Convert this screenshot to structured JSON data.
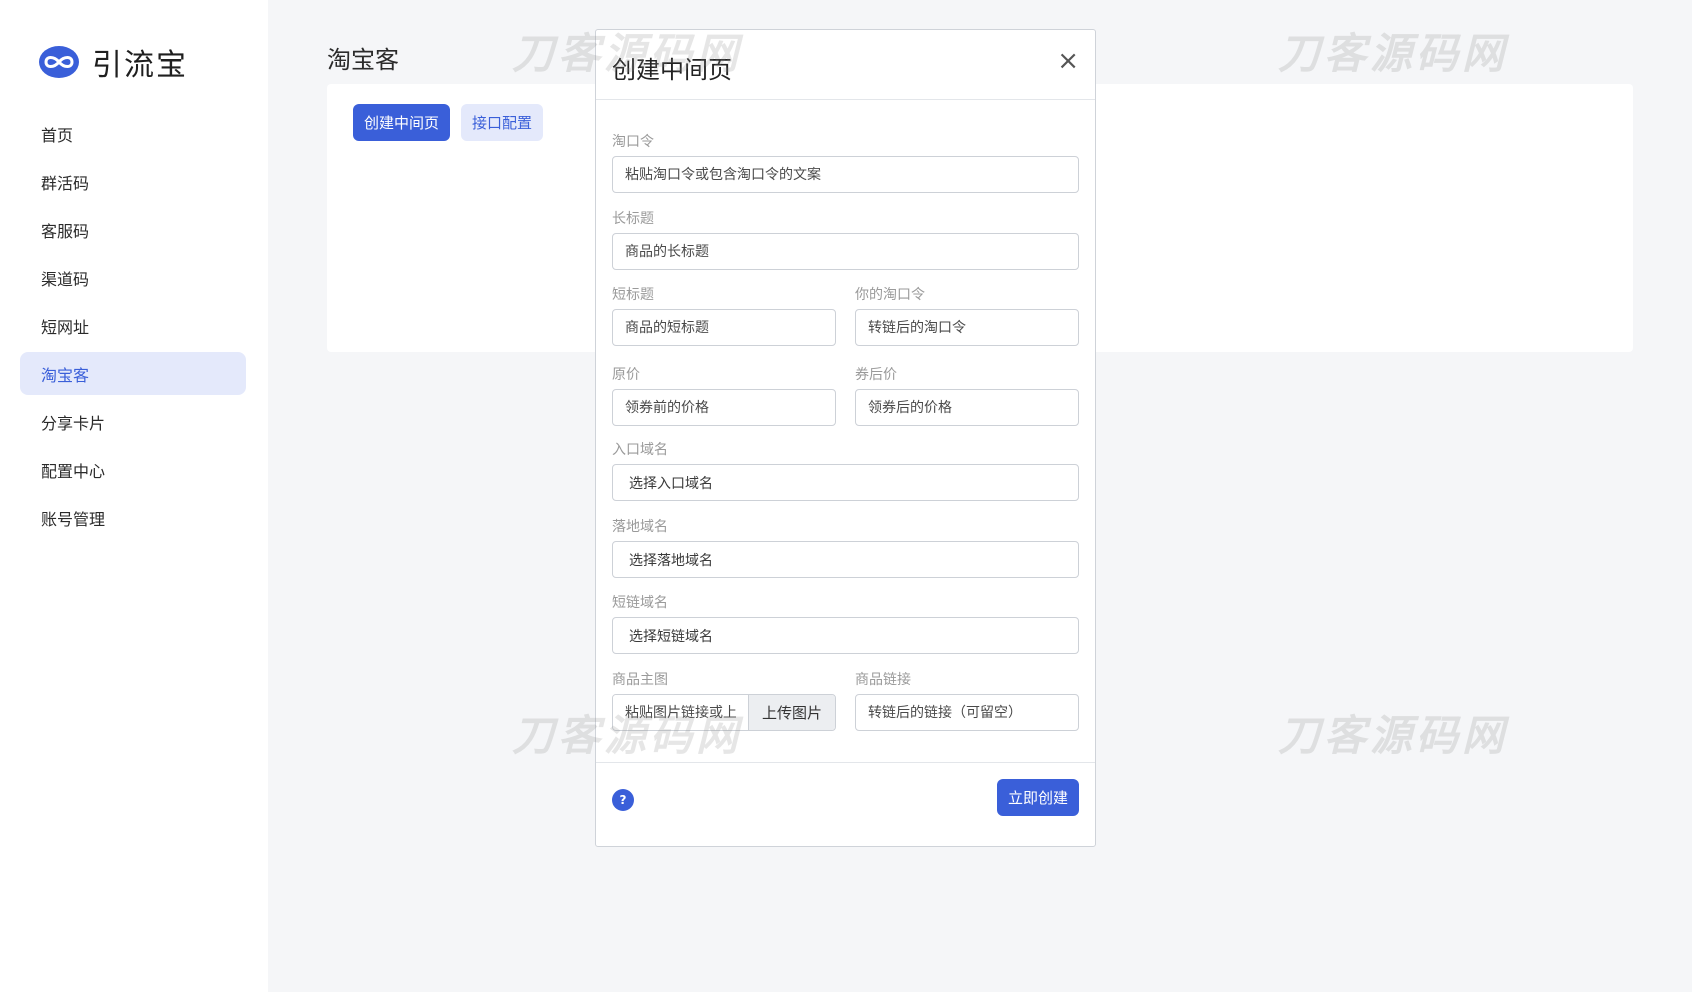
{
  "brand": {
    "name": "引流宝",
    "logo_icon": "infinity-logo-icon",
    "accent": "#3a5fd9"
  },
  "sidebar": {
    "items": [
      {
        "label": "首页",
        "active": false
      },
      {
        "label": "群活码",
        "active": false
      },
      {
        "label": "客服码",
        "active": false
      },
      {
        "label": "渠道码",
        "active": false
      },
      {
        "label": "短网址",
        "active": false
      },
      {
        "label": "淘宝客",
        "active": true
      },
      {
        "label": "分享卡片",
        "active": false
      },
      {
        "label": "配置中心",
        "active": false
      },
      {
        "label": "账号管理",
        "active": false
      }
    ]
  },
  "main": {
    "title": "淘宝客",
    "create_button": "创建中间页",
    "api_config_button": "接口配置"
  },
  "watermark": {
    "text": "刀客源码网"
  },
  "modal": {
    "title": "创建中间页",
    "close_icon": "close-icon",
    "fields": {
      "tkl": {
        "label": "淘口令",
        "placeholder": "粘贴淘口令或包含淘口令的文案"
      },
      "long_title": {
        "label": "长标题",
        "placeholder": "商品的长标题"
      },
      "short_title": {
        "label": "短标题",
        "placeholder": "商品的短标题"
      },
      "your_tkl": {
        "label": "你的淘口令",
        "placeholder": "转链后的淘口令"
      },
      "original_price": {
        "label": "原价",
        "placeholder": "领券前的价格"
      },
      "coupon_price": {
        "label": "券后价",
        "placeholder": "领券后的价格"
      },
      "entry_domain": {
        "label": "入口域名",
        "value": "选择入口域名"
      },
      "landing_domain": {
        "label": "落地域名",
        "value": "选择落地域名"
      },
      "short_domain": {
        "label": "短链域名",
        "value": "选择短链域名"
      },
      "main_image": {
        "label": "商品主图",
        "placeholder": "粘贴图片链接或上传",
        "upload_label": "上传图片"
      },
      "product_link": {
        "label": "商品链接",
        "placeholder": "转链后的链接（可留空）"
      }
    },
    "help_icon": "question-icon",
    "help_text": "?",
    "submit_button": "立即创建"
  }
}
